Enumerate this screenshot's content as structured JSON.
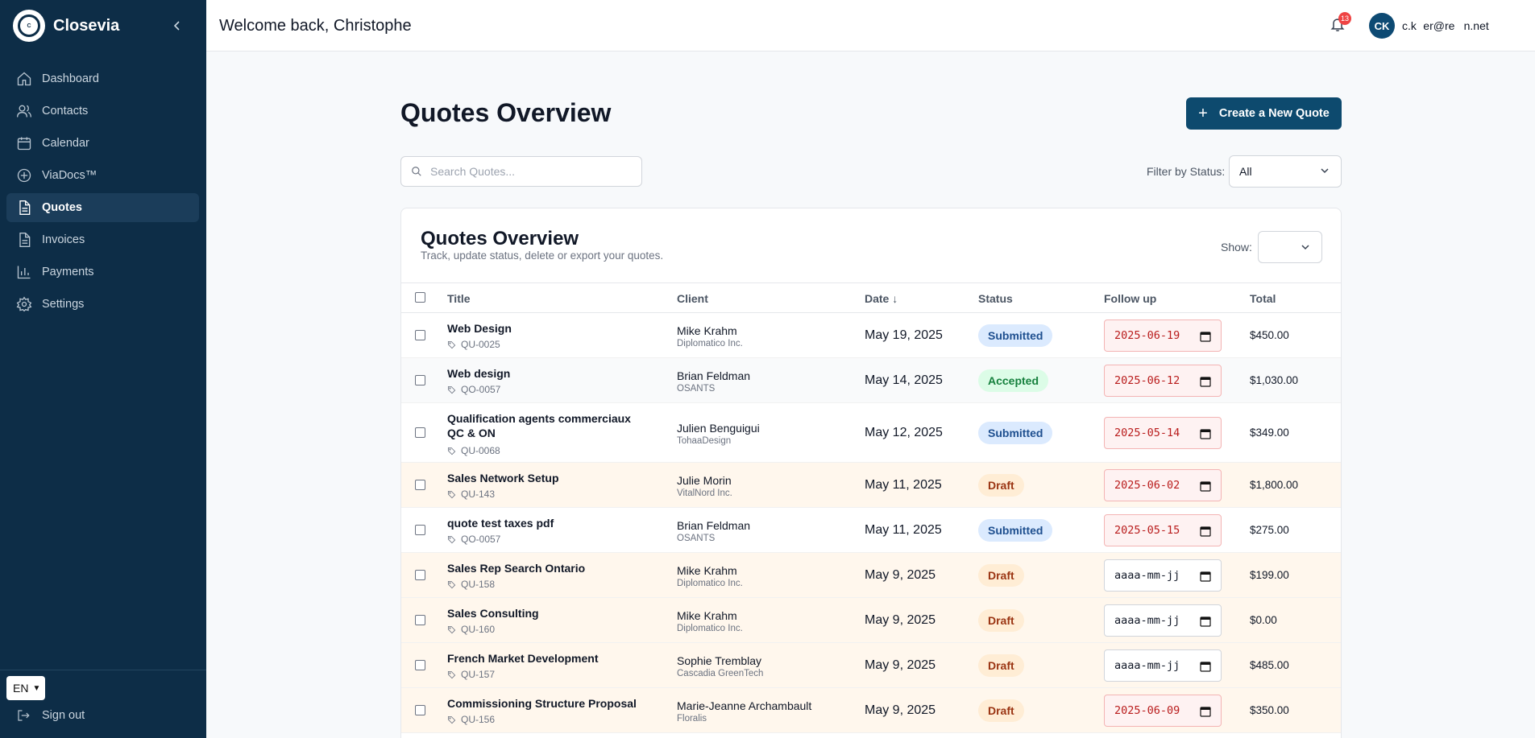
{
  "app": {
    "brand": "Closevia",
    "logo_text": "Closevia"
  },
  "sidebar": {
    "items": [
      {
        "label": "Dashboard",
        "icon": "home-icon"
      },
      {
        "label": "Contacts",
        "icon": "users-icon"
      },
      {
        "label": "Calendar",
        "icon": "calendar-icon"
      },
      {
        "label": "ViaDocs™",
        "icon": "plus-circle-icon"
      },
      {
        "label": "Quotes",
        "icon": "document-icon",
        "active": true
      },
      {
        "label": "Invoices",
        "icon": "document-icon"
      },
      {
        "label": "Payments",
        "icon": "bar-chart-icon"
      },
      {
        "label": "Settings",
        "icon": "gear-icon"
      }
    ],
    "language": "EN",
    "signout": "Sign out"
  },
  "header": {
    "welcome": "Welcome back, Christophe",
    "notification_count": "13",
    "avatar_initials": "CK",
    "user_email": "c.k   er@re    n.net"
  },
  "main": {
    "title": "Quotes Overview",
    "create_button": "Create a New Quote",
    "search_placeholder": "Search Quotes...",
    "filter_label": "Filter by Status:",
    "filter_value": "All"
  },
  "card": {
    "title": "Quotes Overview",
    "subtitle": "Track, update status, delete or export your quotes.",
    "show_label": "Show:",
    "columns": {
      "title": "Title",
      "client": "Client",
      "date": "Date ↓",
      "status": "Status",
      "follow_up": "Follow up",
      "total": "Total"
    }
  },
  "rows": [
    {
      "title": "Web Design",
      "code": "QU-0025",
      "client": "Mike Krahm",
      "company": "Diplomatico Inc.",
      "date": "May 19, 2025",
      "status": "Submitted",
      "follow_up": "2025-06-19",
      "total": "$450.00"
    },
    {
      "title": "Web design",
      "code": "QO-0057",
      "client": "Brian Feldman",
      "company": "OSANTS",
      "date": "May 14, 2025",
      "status": "Accepted",
      "follow_up": "2025-06-12",
      "total": "$1,030.00"
    },
    {
      "title": "Qualification agents commerciaux QC & ON",
      "code": "QU-0068",
      "client": "Julien Benguigui",
      "company": "TohaaDesign",
      "date": "May 12, 2025",
      "status": "Submitted",
      "follow_up": "2025-05-14",
      "total": "$349.00"
    },
    {
      "title": "Sales Network Setup",
      "code": "QU-143",
      "client": "Julie Morin",
      "company": "VitalNord Inc.",
      "date": "May 11, 2025",
      "status": "Draft",
      "follow_up": "2025-06-02",
      "total": "$1,800.00"
    },
    {
      "title": "quote test taxes pdf",
      "code": "QO-0057",
      "client": "Brian Feldman",
      "company": "OSANTS",
      "date": "May 11, 2025",
      "status": "Submitted",
      "follow_up": "2025-05-15",
      "total": "$275.00"
    },
    {
      "title": "Sales Rep Search Ontario",
      "code": "QU-158",
      "client": "Mike Krahm",
      "company": "Diplomatico Inc.",
      "date": "May 9, 2025",
      "status": "Draft",
      "follow_up": "aaaa-mm-jj",
      "total": "$199.00"
    },
    {
      "title": "Sales Consulting",
      "code": "QU-160",
      "client": "Mike Krahm",
      "company": "Diplomatico Inc.",
      "date": "May 9, 2025",
      "status": "Draft",
      "follow_up": "aaaa-mm-jj",
      "total": "$0.00"
    },
    {
      "title": "French Market Development",
      "code": "QU-157",
      "client": "Sophie Tremblay",
      "company": "Cascadia GreenTech",
      "date": "May 9, 2025",
      "status": "Draft",
      "follow_up": "aaaa-mm-jj",
      "total": "$485.00"
    },
    {
      "title": "Commissioning Structure Proposal",
      "code": "QU-156",
      "client": "Marie-Jeanne Archambault",
      "company": "Floralis",
      "date": "May 9, 2025",
      "status": "Draft",
      "follow_up": "2025-06-09",
      "total": "$350.00"
    }
  ],
  "colors": {
    "sidebar_bg": "#0d2d47",
    "primary": "#0d4a6e",
    "draft_row_bg": "#fff7ed"
  }
}
